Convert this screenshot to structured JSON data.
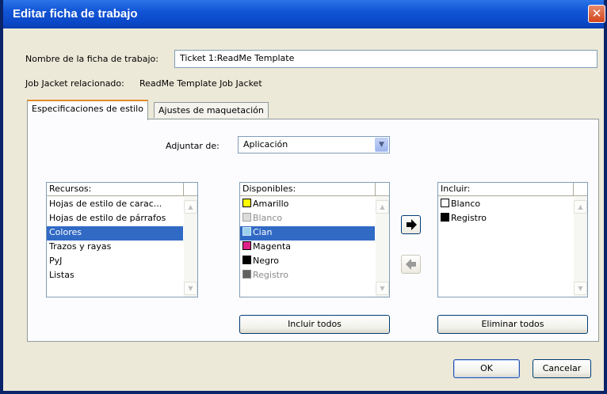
{
  "window": {
    "title": "Editar ficha de trabajo"
  },
  "ticket": {
    "name_label": "Nombre de la ficha de trabajo:",
    "name_value": "Ticket 1:ReadMe Template"
  },
  "jacket": {
    "label": "Job Jacket relacionado:",
    "value": "ReadMe Template Job Jacket"
  },
  "tabs": [
    {
      "label": "Especificaciones de estilo",
      "active": true
    },
    {
      "label": "Ajustes de maquetación",
      "active": false
    }
  ],
  "attach": {
    "label": "Adjuntar de:",
    "value": "Aplicación"
  },
  "resources": {
    "header": "Recursos:",
    "items": [
      {
        "label": "Hojas de estilo de carac..."
      },
      {
        "label": "Hojas de estilo de párrafos"
      },
      {
        "label": "Colores",
        "selected": true
      },
      {
        "label": "Trazos y rayas"
      },
      {
        "label": "PyJ"
      },
      {
        "label": "Listas"
      }
    ]
  },
  "available": {
    "header": "Disponibles:",
    "items": [
      {
        "label": "Amarillo",
        "color": "#ffff00"
      },
      {
        "label": "Blanco",
        "color": "#dcdcdc",
        "dimmed": true
      },
      {
        "label": "Cian",
        "color": "#9ad0ec",
        "selected": true
      },
      {
        "label": "Magenta",
        "color": "#e0208a"
      },
      {
        "label": "Negro",
        "color": "#000000"
      },
      {
        "label": "Registro",
        "color": "#606060",
        "dimmed": true
      }
    ]
  },
  "include": {
    "header": "Incluir:",
    "items": [
      {
        "label": "Blanco",
        "color": "#ffffff"
      },
      {
        "label": "Registro",
        "color": "#000000"
      }
    ]
  },
  "buttons": {
    "include_all": "Incluir todos",
    "remove_all": "Eliminar todos",
    "ok": "OK",
    "cancel": "Cancelar"
  },
  "icons": {
    "close": "close-icon",
    "move_right": "arrow-right-icon",
    "move_left": "arrow-left-icon",
    "dropdown": "chevron-down-icon"
  }
}
